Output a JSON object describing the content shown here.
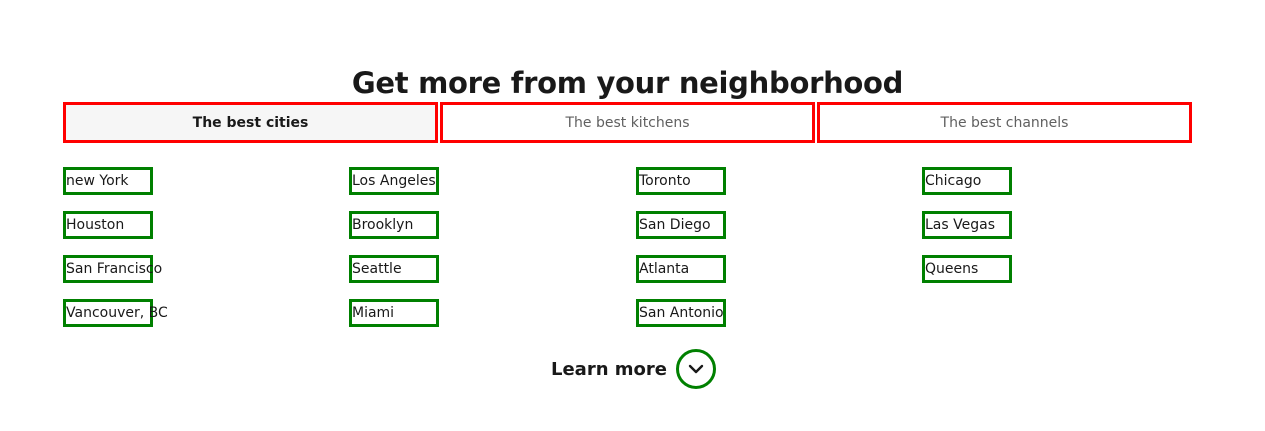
{
  "header": {
    "title": "Get more from your neighborhood"
  },
  "tabs": [
    {
      "label": "The best cities",
      "active": true
    },
    {
      "label": "The best kitchens",
      "active": false
    },
    {
      "label": "The best channels",
      "active": false
    }
  ],
  "cities": {
    "columns": [
      [
        "new York",
        "Houston",
        "San Francisco",
        "Vancouver, BC"
      ],
      [
        "Los Angeles",
        "Brooklyn",
        "Seattle",
        "Miami"
      ],
      [
        "Toronto",
        "San Diego",
        "Atlanta",
        "San Antonio"
      ],
      [
        "Chicago",
        "Las Vegas",
        "Queens"
      ]
    ]
  },
  "learn_more": {
    "label": "Learn more",
    "icon": "chevron-down-icon"
  },
  "colors": {
    "tab_outline": "#ff0000",
    "link_outline": "#008000",
    "active_tab_bg": "#f6f6f6",
    "text": "#191919",
    "muted_text": "#606060"
  }
}
